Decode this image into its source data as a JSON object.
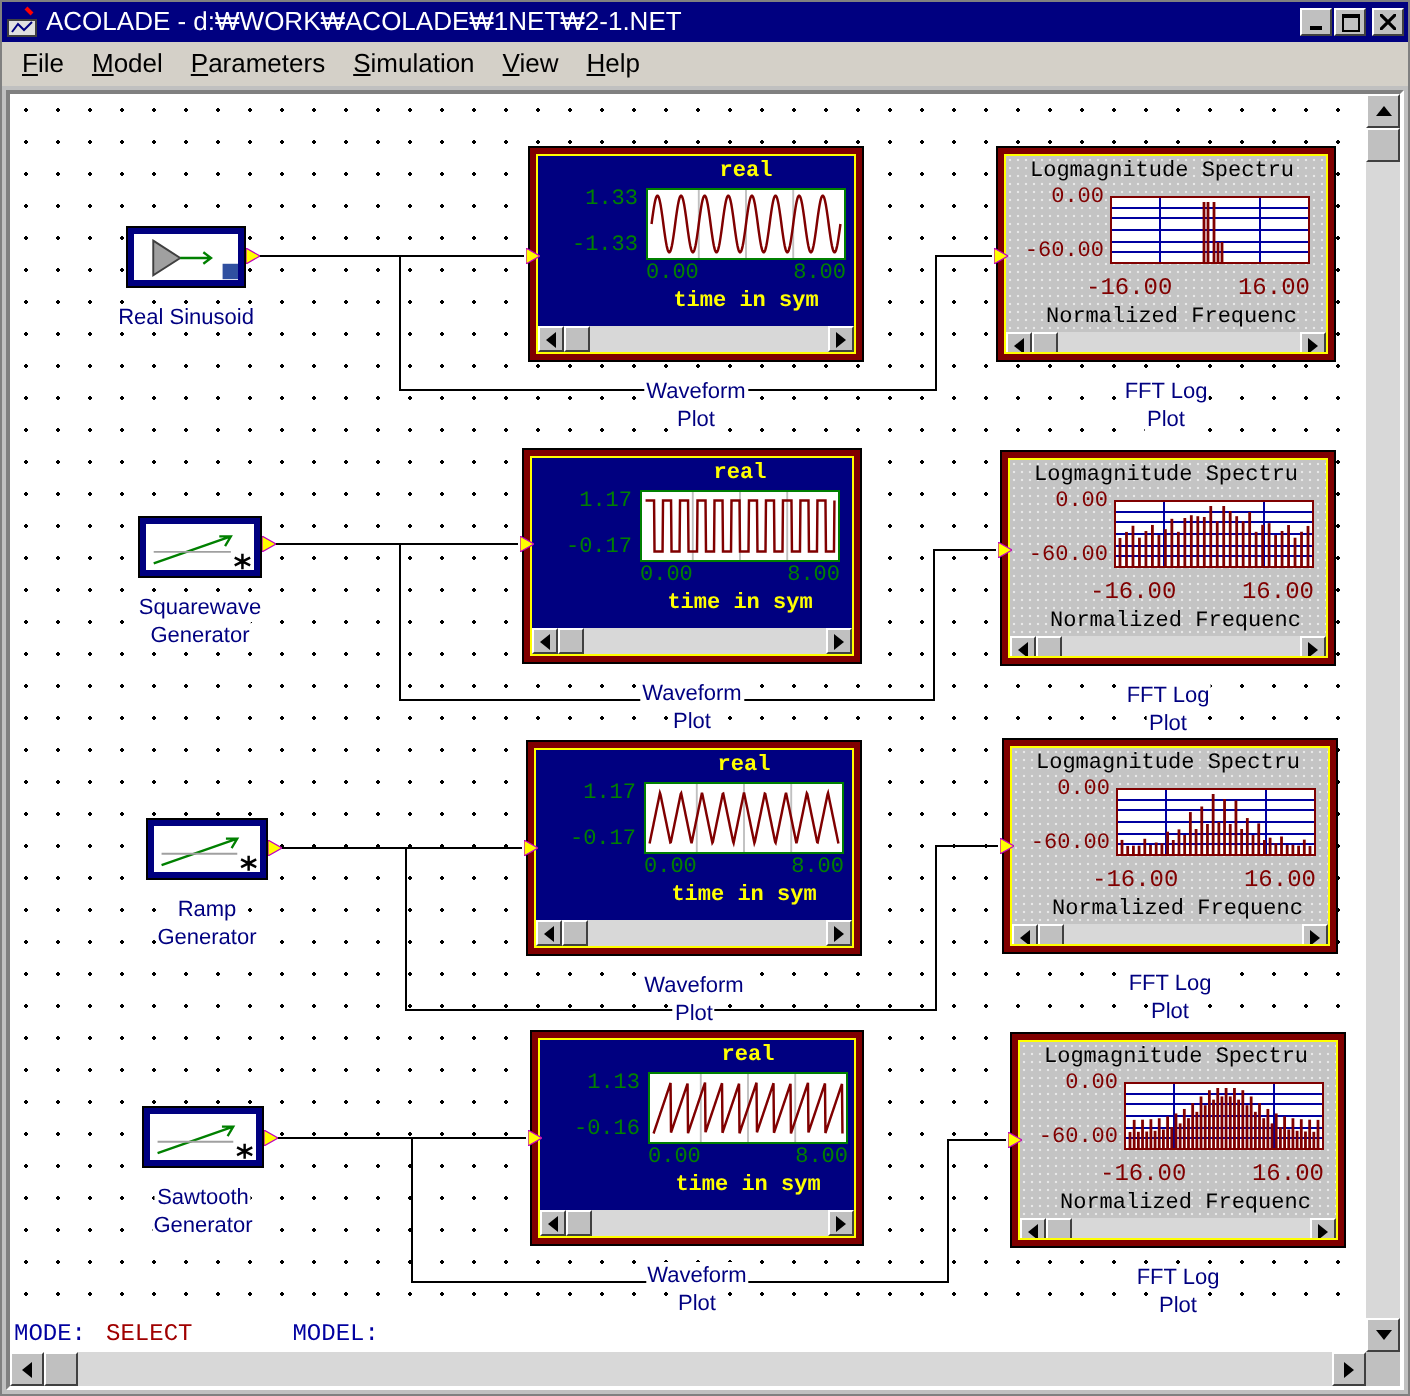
{
  "window": {
    "title": "ACOLADE - d:₩WORK₩ACOLADE₩1NET₩2-1.NET"
  },
  "menu": [
    "File",
    "Model",
    "Parameters",
    "Simulation",
    "View",
    "Help"
  ],
  "chains": [
    {
      "source": {
        "kind": "sinusoid",
        "label": [
          "Real Sinusoid"
        ]
      },
      "waveform": {
        "kind": "sine",
        "title": "real",
        "y_max": "1.33",
        "y_min": "-1.33",
        "x_min": "0.00",
        "x_max": "8.00",
        "xlabel": "time in sym",
        "label": [
          "Waveform",
          "Plot"
        ]
      },
      "spectrum": {
        "kind": "tone",
        "title": "Logmagnitude Spectru",
        "y_max": "0.00",
        "y_min": "-60.00",
        "x_min": "-16.00",
        "x_max": "16.00",
        "xlabel": "Normalized Frequenc",
        "label": [
          "FFT Log",
          "Plot"
        ]
      }
    },
    {
      "source": {
        "kind": "generator",
        "label": [
          "Squarewave",
          "Generator"
        ]
      },
      "waveform": {
        "kind": "square",
        "title": "real",
        "y_max": "1.17",
        "y_min": "-0.17",
        "x_min": "0.00",
        "x_max": "8.00",
        "xlabel": "time in sym",
        "label": [
          "Waveform",
          "Plot"
        ]
      },
      "spectrum": {
        "kind": "lines",
        "title": "Logmagnitude Spectru",
        "y_max": "0.00",
        "y_min": "-60.00",
        "x_min": "-16.00",
        "x_max": "16.00",
        "xlabel": "Normalized Frequenc",
        "label": [
          "FFT Log",
          "Plot"
        ]
      }
    },
    {
      "source": {
        "kind": "generator",
        "label": [
          "Ramp",
          "Generator"
        ]
      },
      "waveform": {
        "kind": "triangle",
        "title": "real",
        "y_max": "1.17",
        "y_min": "-0.17",
        "x_min": "0.00",
        "x_max": "8.00",
        "xlabel": "time in sym",
        "label": [
          "Waveform",
          "Plot"
        ]
      },
      "spectrum": {
        "kind": "sparse",
        "title": "Logmagnitude Spectru",
        "y_max": "0.00",
        "y_min": "-60.00",
        "x_min": "-16.00",
        "x_max": "16.00",
        "xlabel": "Normalized Frequenc",
        "label": [
          "FFT Log",
          "Plot"
        ]
      }
    },
    {
      "source": {
        "kind": "generator",
        "label": [
          "Sawtooth",
          "Generator"
        ]
      },
      "waveform": {
        "kind": "sawtooth",
        "title": "real",
        "y_max": "1.13",
        "y_min": "-0.16",
        "x_min": "0.00",
        "x_max": "8.00",
        "xlabel": "time in sym",
        "label": [
          "Waveform",
          "Plot"
        ]
      },
      "spectrum": {
        "kind": "dense",
        "title": "Logmagnitude Spectru",
        "y_max": "0.00",
        "y_min": "-60.00",
        "x_min": "-16.00",
        "x_max": "16.00",
        "xlabel": "Normalized Frequenc",
        "label": [
          "FFT Log",
          "Plot"
        ]
      }
    }
  ],
  "status": {
    "mode_label": "MODE:",
    "mode": "SELECT",
    "model_label": "MODEL:"
  }
}
